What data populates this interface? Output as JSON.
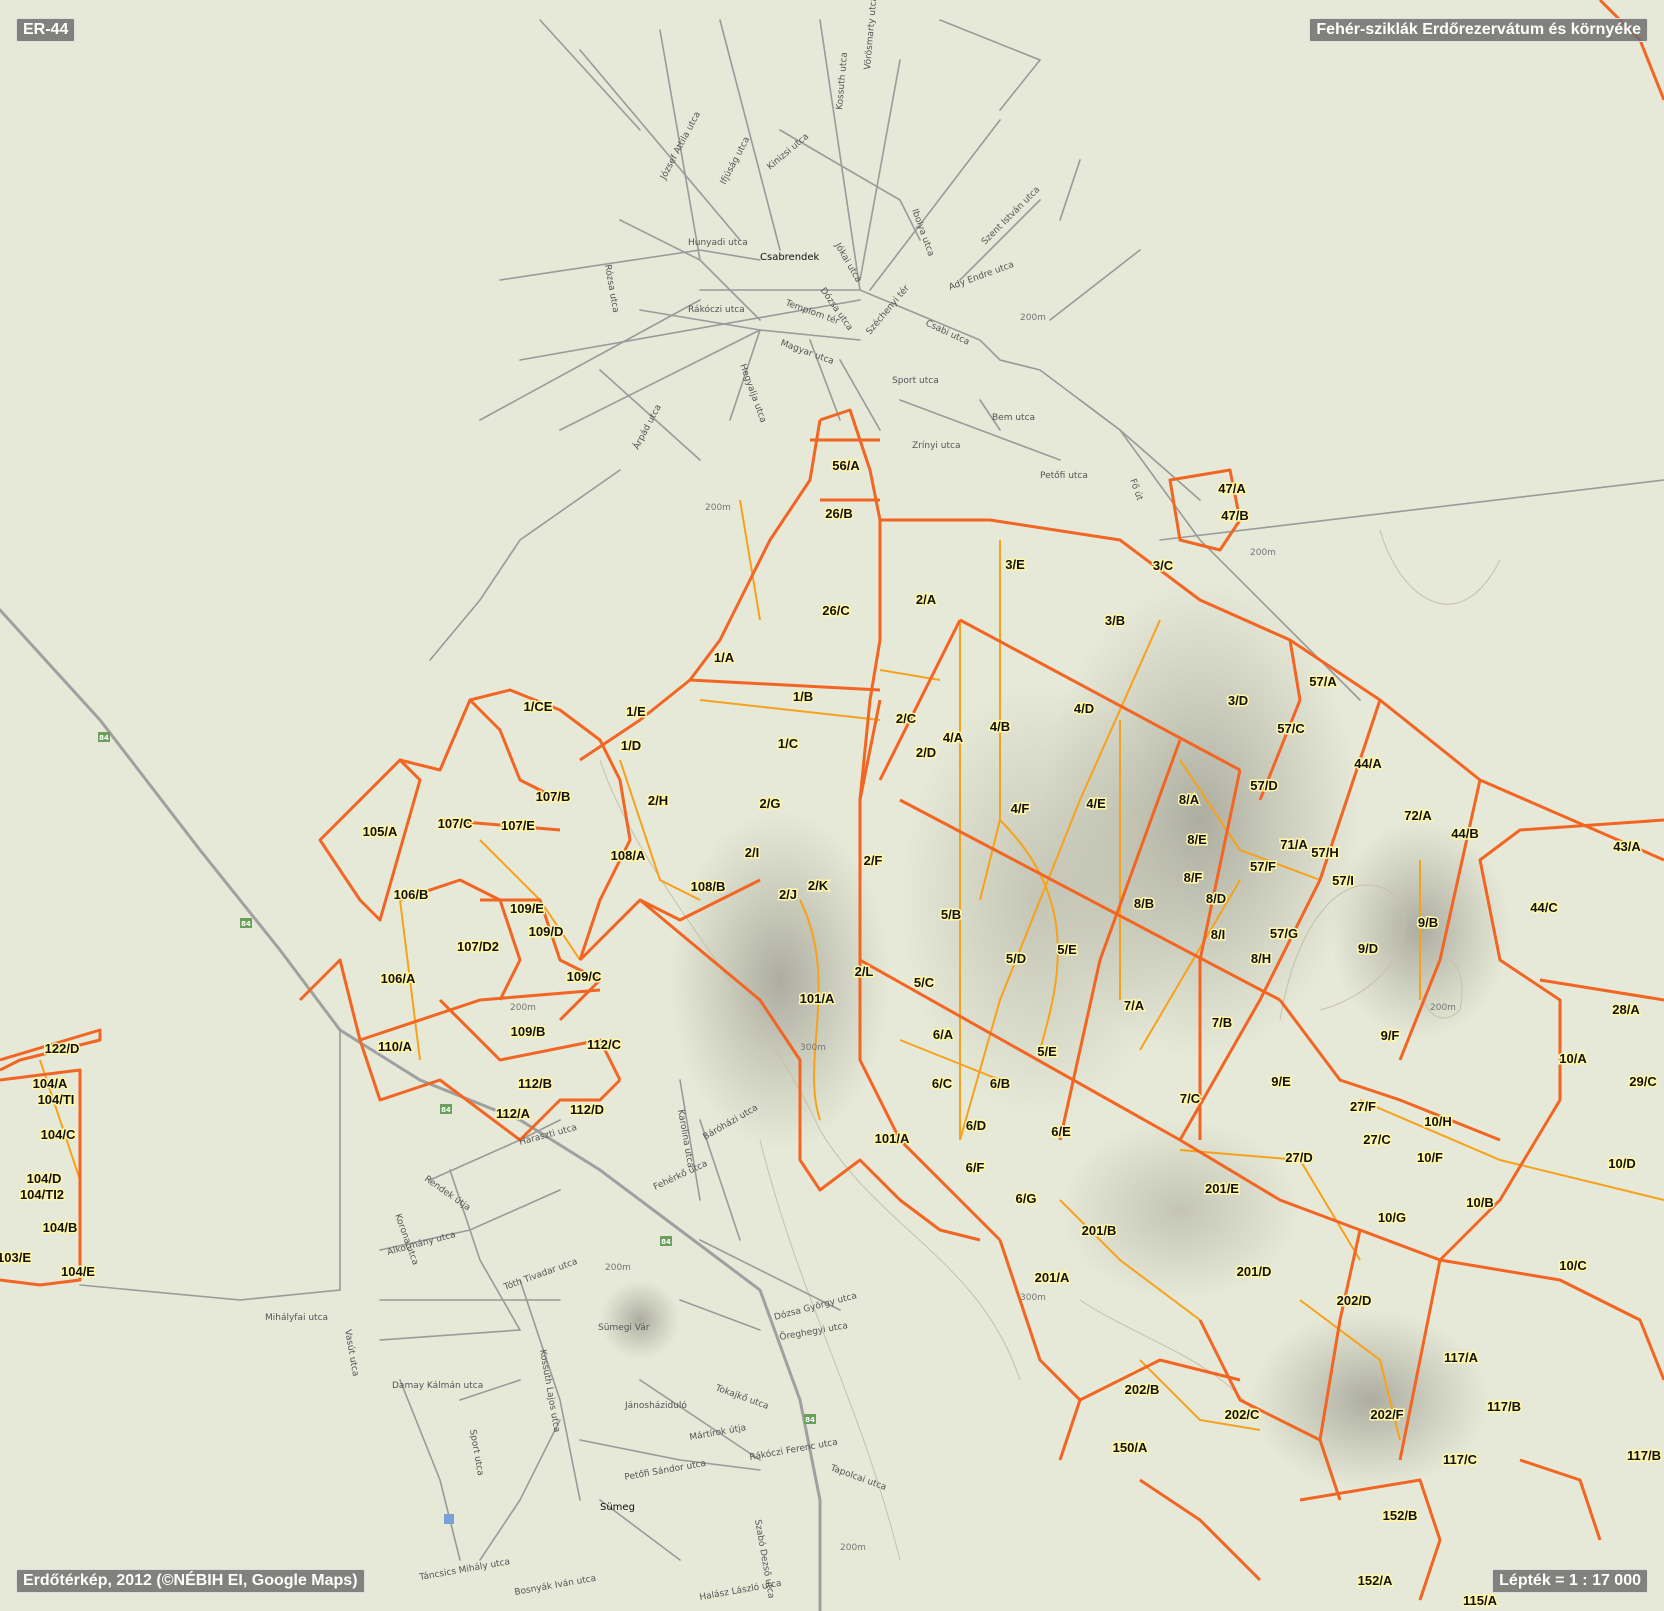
{
  "map_id": "ER-44",
  "title": "Fehér-sziklák Erdőrezervátum és környéke",
  "attribution": "Erdőtérkép, 2012 (©NÉBIH EI, Google Maps)",
  "scale": "Lépték = 1 : 17 000",
  "colors": {
    "background": "#e6e8d8",
    "road": "#9a9a9a",
    "highway": "#a0a0a0",
    "boundary_major": "#f26522",
    "boundary_minor": "#f7a21a",
    "label_halo": "#fff6a8",
    "contour": "#c8c0a8"
  },
  "places": {
    "north_village": "Csabrendek",
    "south_town": "Sümeg",
    "castle": "Sümegi Vár",
    "district": "Jánosháziduló"
  },
  "road_number": "84",
  "contour_label": "200m",
  "contour_label_300": "300m",
  "streets": {
    "s1": "József Attila utca",
    "s2": "Ifjúság utca",
    "s3": "Kinizsi utca",
    "s4": "Kossuth utca",
    "s5": "Vörösmarty utca",
    "s6": "Hunyadi utca",
    "s7": "Jókai utca",
    "s8": "Ibolya utca",
    "s9": "Szent István utca",
    "s10": "Rózsa utca",
    "s11": "Rákóczi utca",
    "s12": "Dózsa utca",
    "s13": "Templom tér",
    "s14": "Ady Endre utca",
    "s15": "Széchenyi tér",
    "s16": "Csabi utca",
    "s17": "Magyar utca",
    "s18": "Hegyalja utca",
    "s19": "Sport utca",
    "s20": "Árpád utca",
    "s21": "Bem utca",
    "s22": "Zrínyi utca",
    "s23": "Petőfi utca",
    "s24": "Fő út",
    "s25": "Haraszti utca",
    "s26": "Rendek útja",
    "s27": "Alkotmány utca",
    "s28": "Mihályfai utca",
    "s29": "Korona utca",
    "s30": "Tóth Tivadar utca",
    "s31": "Vasút utca",
    "s32": "Damay Kálmán utca",
    "s33": "Sport utca",
    "s34": "Karolina utca",
    "s35": "Báróházi utca",
    "s36": "Fehérkő utca",
    "s37": "Dózsa György utca",
    "s38": "Öreghegyi utca",
    "s39": "Tokajkő utca",
    "s40": "Mártírok útja",
    "s41": "Petőfi Sándor utca",
    "s42": "Rákóczi Ferenc utca",
    "s43": "Tapolcai utca",
    "s44": "Táncsics Mihály utca",
    "s45": "Bosnyák Iván utca",
    "s46": "Halász László utca",
    "s47": "Kossuth Lajos utca",
    "s48": "Szabó Dezső utca"
  },
  "compartments": {
    "c1": "56/A",
    "c2": "26/B",
    "c3": "26/C",
    "c4": "2/A",
    "c5": "3/E",
    "c6": "3/C",
    "c7": "3/B",
    "c8": "47/A",
    "c9": "47/B",
    "c10": "1/A",
    "c11": "1/B",
    "c12": "1/CE",
    "c13": "1/E",
    "c14": "1/D",
    "c15": "1/C",
    "c16": "2/C",
    "c17": "2/D",
    "c18": "4/A",
    "c19": "4/B",
    "c20": "4/D",
    "c21": "3/D",
    "c22": "57/A",
    "c23": "57/C",
    "c24": "44/A",
    "c25": "57/D",
    "c26": "107/B",
    "c27": "2/H",
    "c28": "2/G",
    "c29": "105/A",
    "c30": "107/C",
    "c31": "107/E",
    "c32": "4/F",
    "c33": "4/E",
    "c34": "8/A",
    "c35": "72/A",
    "c36": "44/B",
    "c37": "43/A",
    "c38": "108/A",
    "c39": "2/I",
    "c40": "2/F",
    "c41": "8/E",
    "c42": "71/A",
    "c43": "57/H",
    "c44": "57/F",
    "c45": "57/I",
    "c46": "108/B",
    "c47": "2/K",
    "c48": "2/J",
    "c49": "106/B",
    "c50": "8/F",
    "c51": "8/D",
    "c52": "8/B",
    "c53": "109/E",
    "c54": "5/B",
    "c55": "44/C",
    "c56": "9/B",
    "c57": "107/D2",
    "c58": "109/D",
    "c59": "8/I",
    "c60": "57/G",
    "c61": "5/E",
    "c62": "9/D",
    "c63": "106/A",
    "c64": "5/D",
    "c65": "8/H",
    "c66": "2/L",
    "c67": "109/C",
    "c68": "5/C",
    "c69": "101/A",
    "c70": "7/A",
    "c71": "28/A",
    "c72": "7/B",
    "c73": "6/A",
    "c74": "109/B",
    "c75": "112/C",
    "c76": "110/A",
    "c77": "5/E",
    "c78": "9/F",
    "c79": "10/A",
    "c80": "112/B",
    "c81": "6/C",
    "c82": "6/B",
    "c83": "9/E",
    "c84": "29/C",
    "c85": "112/A",
    "c86": "112/D",
    "c87": "7/C",
    "c88": "27/F",
    "c89": "10/H",
    "c90": "6/D",
    "c91": "27/C",
    "c92": "6/E",
    "c93": "101/A",
    "c94": "27/D",
    "c95": "10/F",
    "c96": "10/D",
    "c97": "6/F",
    "c98": "201/E",
    "c99": "6/G",
    "c100": "10/G",
    "c101": "10/B",
    "c102": "201/B",
    "c103": "201/D",
    "c104": "10/C",
    "c105": "201/A",
    "c106": "202/D",
    "c107": "117/A",
    "c108": "202/B",
    "c109": "117/B",
    "c110": "202/C",
    "c111": "202/F",
    "c112": "150/A",
    "c113": "117/C",
    "c114": "117/B",
    "c115": "152/B",
    "c116": "152/A",
    "c117": "115/A",
    "c118": "122/D",
    "c119": "104/A",
    "c120": "104/TI",
    "c121": "104/C",
    "c122": "104/D",
    "c123": "104/TI2",
    "c124": "104/B",
    "c125": "103/E",
    "c126": "104/E"
  }
}
